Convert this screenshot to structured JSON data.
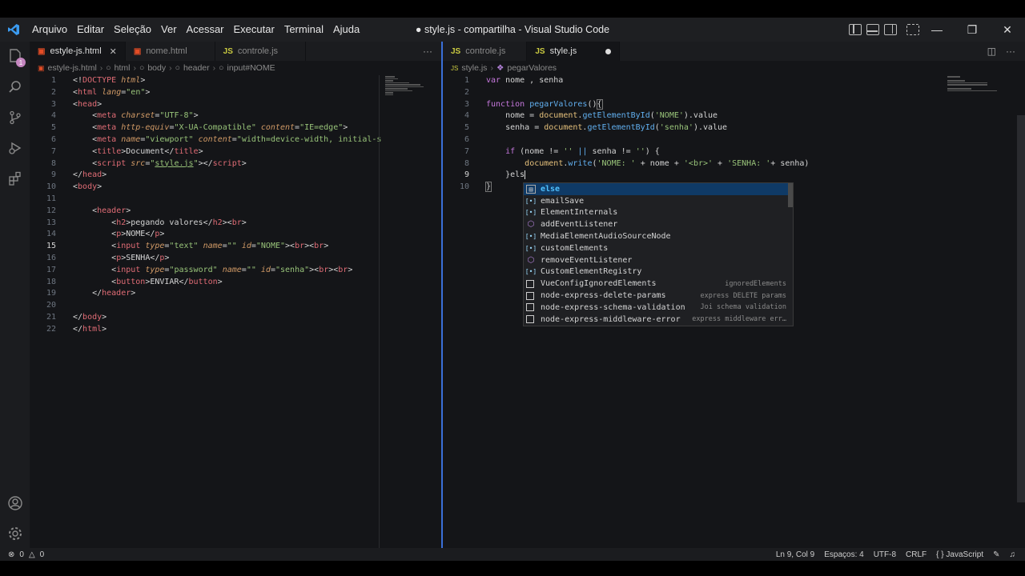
{
  "window": {
    "title": "● style.js - compartilha - Visual Studio Code",
    "menu": [
      "Arquivo",
      "Editar",
      "Seleção",
      "Ver",
      "Acessar",
      "Executar",
      "Terminal",
      "Ajuda"
    ]
  },
  "activity_bar": {
    "items": [
      "explorer-icon",
      "search-icon",
      "source-control-icon",
      "run-debug-icon",
      "extensions-icon"
    ],
    "bottom": [
      "account-icon",
      "settings-gear-icon"
    ],
    "explorer_badge": "1"
  },
  "left_editor": {
    "tabs": [
      {
        "label": "estyle-js.html",
        "type": "HTML",
        "active": true
      },
      {
        "label": "nome.html",
        "type": "HTML",
        "active": false
      },
      {
        "label": "controle.js",
        "type": "JS",
        "active": false
      }
    ],
    "breadcrumb": [
      "estyle-js.html",
      "html",
      "body",
      "header",
      "input#NOME"
    ],
    "current_line": 15,
    "line_numbers": [
      "1",
      "2",
      "3",
      "4",
      "5",
      "6",
      "7",
      "8",
      "9",
      "10",
      "11",
      "12",
      "13",
      "14",
      "15",
      "16",
      "17",
      "18",
      "19",
      "20",
      "21",
      "22"
    ]
  },
  "right_editor": {
    "tabs": [
      {
        "label": "controle.js",
        "type": "JS",
        "active": false
      },
      {
        "label": "style.js",
        "type": "JS",
        "active": true,
        "dirty": true
      }
    ],
    "breadcrumb": [
      "style.js",
      "pegarValores"
    ],
    "current_line": 9,
    "line_numbers": [
      "1",
      "2",
      "3",
      "4",
      "5",
      "6",
      "7",
      "8",
      "9",
      "10"
    ]
  },
  "suggest": {
    "items": [
      {
        "label": "else",
        "match": "els",
        "kind": "keyword",
        "detail": ""
      },
      {
        "label": "emailSave",
        "match": "e",
        "kind": "variable",
        "detail": ""
      },
      {
        "label": "ElementInternals",
        "match": "El",
        "kind": "variable",
        "detail": ""
      },
      {
        "label": "addEventListener",
        "match": "",
        "kind": "method",
        "detail": ""
      },
      {
        "label": "MediaElementAudioSourceNode",
        "match": "",
        "kind": "variable",
        "detail": ""
      },
      {
        "label": "customElements",
        "match": "",
        "kind": "variable",
        "detail": ""
      },
      {
        "label": "removeEventListener",
        "match": "",
        "kind": "method",
        "detail": ""
      },
      {
        "label": "CustomElementRegistry",
        "match": "",
        "kind": "variable",
        "detail": ""
      },
      {
        "label": "VueConfigIgnoredElements",
        "match": "",
        "kind": "snippet",
        "detail": "ignoredElements"
      },
      {
        "label": "node-express-delete-params",
        "match": "",
        "kind": "snippet",
        "detail": "express DELETE params"
      },
      {
        "label": "node-express-schema-validation",
        "match": "",
        "kind": "snippet",
        "detail": "Joi schema validation"
      },
      {
        "label": "node-express-middleware-error",
        "match": "",
        "kind": "snippet",
        "detail": "express middleware err…"
      }
    ]
  },
  "status": {
    "errors": "0",
    "warnings": "0",
    "position": "Ln 9, Col 9",
    "spaces": "Espaços: 4",
    "encoding": "UTF-8",
    "eol": "CRLF",
    "language": "JavaScript"
  }
}
